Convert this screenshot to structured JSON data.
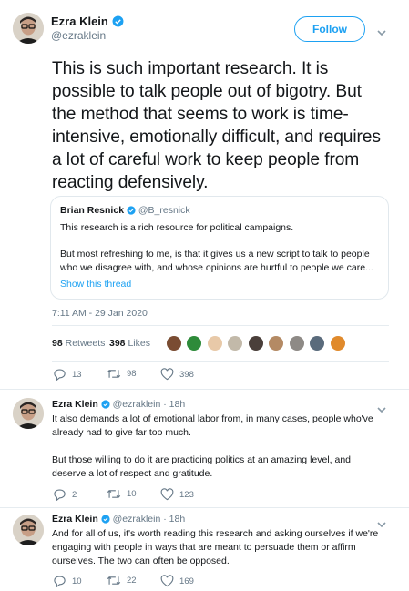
{
  "main_tweet": {
    "author_name": "Ezra Klein",
    "author_handle": "@ezraklein",
    "follow_label": "Follow",
    "text": "This is such important research. It is possible to talk people out of bigotry. But the method that seems to work is time-intensive, emotionally difficult, and requires a lot of careful work to keep people from reacting defensively.",
    "quoted": {
      "author_name": "Brian Resnick",
      "author_handle": "@B_resnick",
      "line1": "This research is a rich resource for political campaigns.",
      "line2": "But most refreshing to me, is that it gives us a new script to talk to people who we disagree with, and whose opinions are hurtful to people we care...",
      "show_thread": "Show this thread"
    },
    "timestamp": "7:11 AM - 29 Jan 2020",
    "retweets_count": "98",
    "retweets_label": "Retweets",
    "likes_count": "398",
    "likes_label": "Likes",
    "actions": {
      "replies": "13",
      "retweets": "98",
      "likes": "398"
    }
  },
  "replies": [
    {
      "author_name": "Ezra Klein",
      "author_handle": "@ezraklein",
      "time": "· 18h",
      "text1": "It also demands a lot of emotional labor from, in many cases, people who've already had to give far too much.",
      "text2": "But those willing to do it are practicing politics at an amazing level, and deserve a lot of respect and gratitude.",
      "actions": {
        "replies": "2",
        "retweets": "10",
        "likes": "123"
      }
    },
    {
      "author_name": "Ezra Klein",
      "author_handle": "@ezraklein",
      "time": "· 18h",
      "text1": "And for all of us, it's worth reading this research and asking ourselves if we're engaging with people in ways that are meant to persuade them or affirm ourselves. The two can often be opposed.",
      "actions": {
        "replies": "10",
        "retweets": "22",
        "likes": "169"
      }
    }
  ],
  "colors": {
    "accent": "#1da1f2",
    "muted": "#657786",
    "divider": "#e6ecf0"
  },
  "icons": [
    "verified-badge-icon",
    "chevron-down-icon",
    "reply-icon",
    "retweet-icon",
    "like-icon"
  ]
}
